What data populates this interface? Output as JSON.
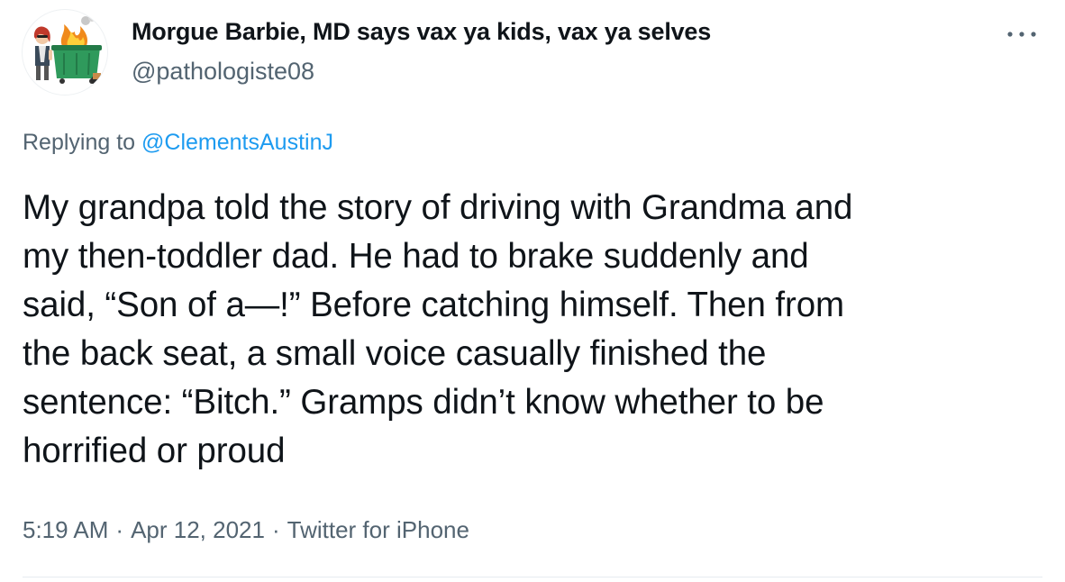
{
  "author": {
    "display_name": "Morgue Barbie, MD says vax ya kids, vax ya selves",
    "handle": "@pathologiste08",
    "avatar_icon": "avatar-dumpster-fire-bitmoji"
  },
  "more_icon": "more-horizontal-icon",
  "reply": {
    "prefix": "Replying to",
    "mention": "@ClementsAustinJ"
  },
  "tweet_lines": [
    "My grandpa told the story of driving with Grandma and",
    "my then-toddler dad. He had to brake suddenly and",
    "said, “Son of a—!” Before catching himself. Then from",
    "the back seat, a small voice casually finished the",
    "sentence: “Bitch.” Gramps didn’t know whether to be",
    "horrified or proud"
  ],
  "meta": {
    "time": "5:19 AM",
    "separator": "·",
    "date": "Apr 12, 2021",
    "source": "Twitter for iPhone"
  },
  "colors": {
    "text": "#0f1419",
    "secondary": "#536471",
    "link": "#1d9bf0",
    "divider": "#e6ecf0"
  }
}
